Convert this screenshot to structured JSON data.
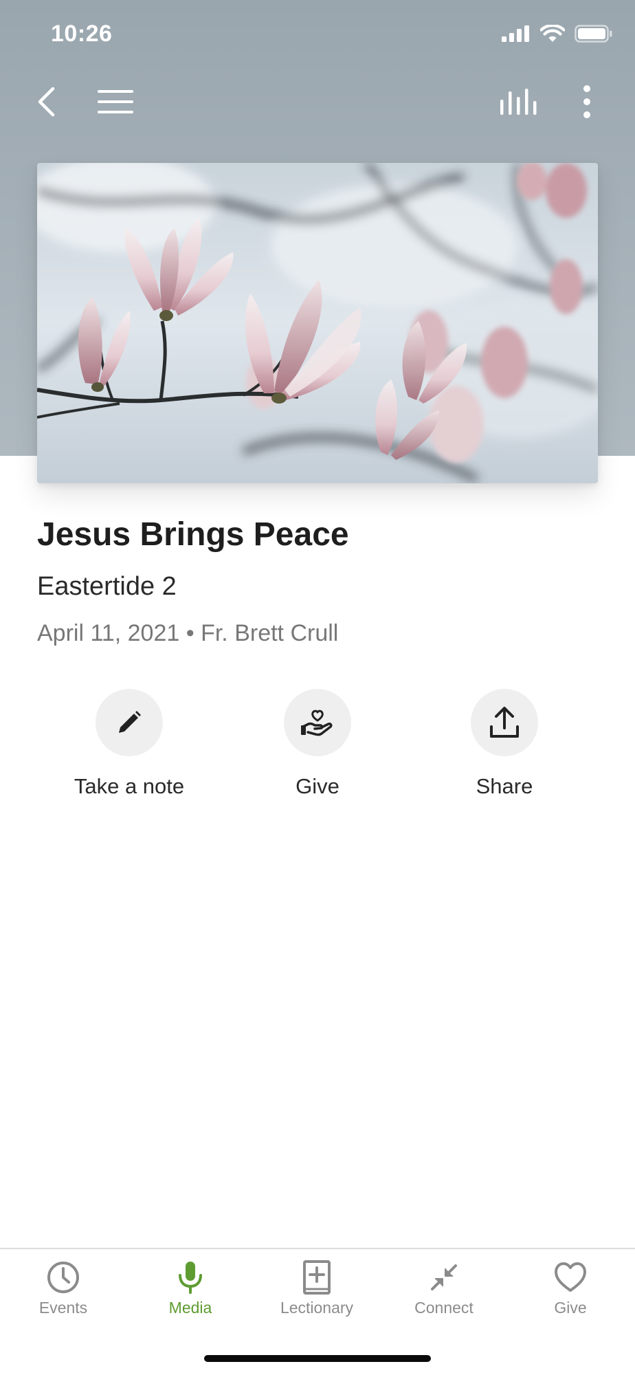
{
  "status_bar": {
    "time": "10:26"
  },
  "nav": {
    "back_icon": "chevron-left-icon",
    "menu_icon": "hamburger-menu-icon",
    "audio_icon": "audio-bars-icon",
    "more_icon": "more-vertical-icon"
  },
  "content": {
    "title": "Jesus Brings Peace",
    "subtitle": "Eastertide 2",
    "meta": "April 11, 2021 • Fr. Brett Crull"
  },
  "actions": [
    {
      "label": "Take a note",
      "icon": "pencil-icon"
    },
    {
      "label": "Give",
      "icon": "heart-hand-icon"
    },
    {
      "label": "Share",
      "icon": "share-upload-icon"
    }
  ],
  "tabs": [
    {
      "label": "Events",
      "icon": "clock-icon",
      "active": false
    },
    {
      "label": "Media",
      "icon": "microphone-icon",
      "active": true
    },
    {
      "label": "Lectionary",
      "icon": "book-plus-icon",
      "active": false
    },
    {
      "label": "Connect",
      "icon": "connect-arrows-icon",
      "active": false
    },
    {
      "label": "Give",
      "icon": "heart-icon",
      "active": false
    }
  ],
  "colors": {
    "accent": "#5e9c32",
    "inactive_tab": "#8b8b8b",
    "header_bg": "#a4afb7"
  }
}
